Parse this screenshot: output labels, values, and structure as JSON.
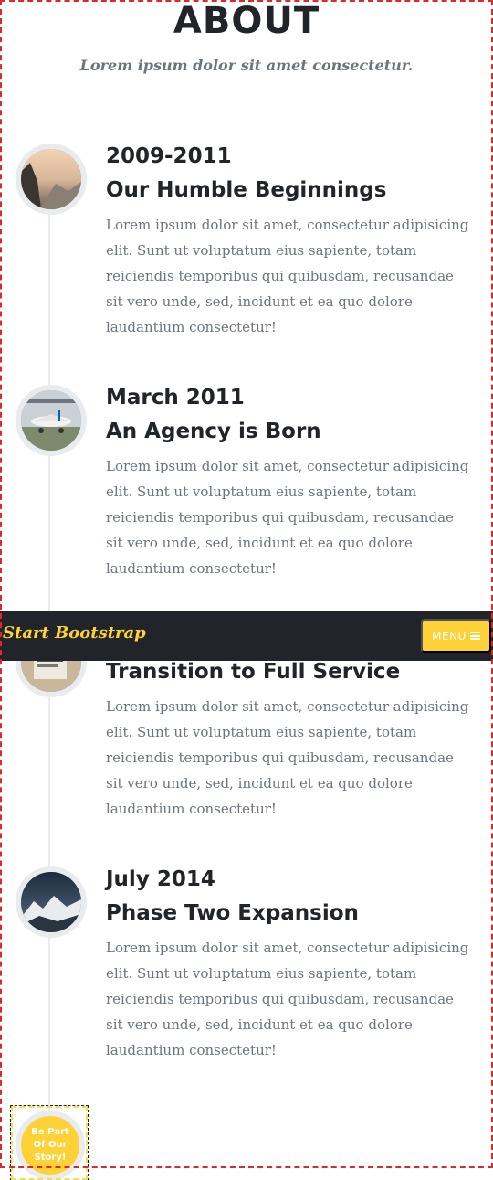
{
  "section": {
    "heading": "ABOUT",
    "subheading": "Lorem ipsum dolor sit amet consectetur."
  },
  "timeline": [
    {
      "date": "2009-2011",
      "title": "Our Humble Beginnings",
      "body": "Lorem ipsum dolor sit amet, consectetur adipisicing elit. Sunt ut voluptatum eius sapiente, totam reiciendis temporibus qui quibusdam, recusandae sit vero unde, sed, incidunt et ea quo dolore laudantium consectetur!",
      "image": "mountain-sunrise-photo"
    },
    {
      "date": "March 2011",
      "title": "An Agency is Born",
      "body": "Lorem ipsum dolor sit amet, consectetur adipisicing elit. Sunt ut voluptatum eius sapiente, totam reiciendis temporibus qui quibusdam, recusandae sit vero unde, sed, incidunt et ea quo dolore laudantium consectetur!",
      "image": "airplane-photo"
    },
    {
      "date": "",
      "title": "Transition to Full Service",
      "body": "Lorem ipsum dolor sit amet, consectetur adipisicing elit. Sunt ut voluptatum eius sapiente, totam reiciendis temporibus qui quibusdam, recusandae sit vero unde, sed, incidunt et ea quo dolore laudantium consectetur!",
      "image": "desk-photo"
    },
    {
      "date": "July 2014",
      "title": "Phase Two Expansion",
      "body": "Lorem ipsum dolor sit amet, consectetur adipisicing elit. Sunt ut voluptatum eius sapiente, totam reiciendis temporibus qui quibusdam, recusandae sit vero unde, sed, incidunt et ea quo dolore laudantium consectetur!",
      "image": "snowy-mountain-photo"
    }
  ],
  "navbar": {
    "brand": "Start Bootstrap",
    "menu_label": "MENU",
    "menu_icon": "hamburger-icon"
  },
  "story_badge": {
    "line1": "Be Part",
    "line2": "Of Our",
    "line3": "Story!"
  },
  "colors": {
    "accent": "#fed136",
    "navbar_bg": "#212529",
    "text_dark": "#212529",
    "text_muted": "#6c757d",
    "timeline_line": "#e9ecef"
  }
}
